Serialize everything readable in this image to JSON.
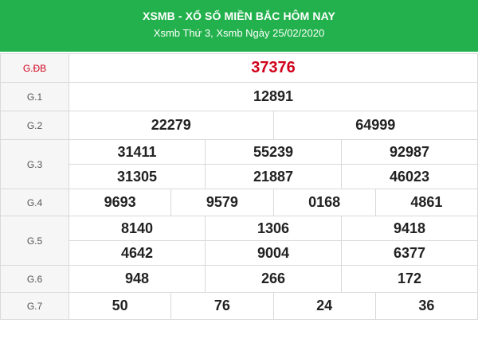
{
  "header": {
    "title": "XSMB - XỔ SỐ MIỀN BẮC HÔM NAY",
    "subtitle": "Xsmb Thứ 3, Xsmb Ngày 25/02/2020",
    "color": "#22b14c"
  },
  "prizes": {
    "gdb": {
      "label": "G.ĐB",
      "numbers": [
        "37376"
      ]
    },
    "g1": {
      "label": "G.1",
      "numbers": [
        "12891"
      ]
    },
    "g2": {
      "label": "G.2",
      "numbers": [
        "22279",
        "64999"
      ]
    },
    "g3": {
      "label": "G.3",
      "numbers": [
        "31411",
        "55239",
        "92987",
        "31305",
        "21887",
        "46023"
      ]
    },
    "g4": {
      "label": "G.4",
      "numbers": [
        "9693",
        "9579",
        "0168",
        "4861"
      ]
    },
    "g5": {
      "label": "G.5",
      "numbers": [
        "8140",
        "1306",
        "9418",
        "4642",
        "9004",
        "6377"
      ]
    },
    "g6": {
      "label": "G.6",
      "numbers": [
        "948",
        "266",
        "172"
      ]
    },
    "g7": {
      "label": "G.7",
      "numbers": [
        "50",
        "76",
        "24",
        "36"
      ]
    }
  },
  "colors": {
    "special": "#d0021b",
    "label_bg": "#f6f6f6",
    "border": "#d9d9d9"
  }
}
